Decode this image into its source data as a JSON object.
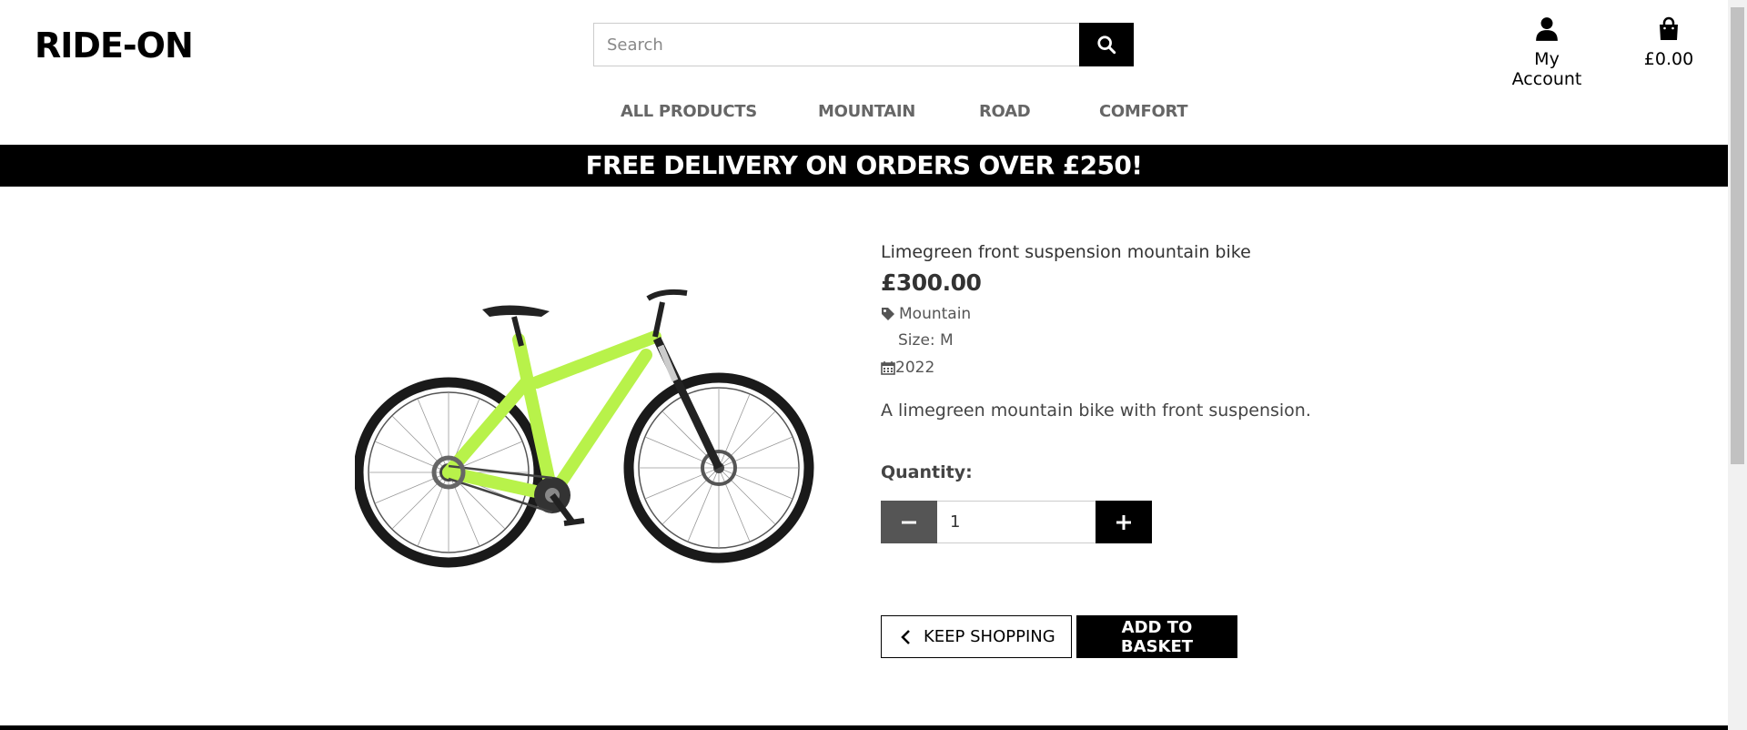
{
  "header": {
    "logo": "RIDE-ON",
    "search": {
      "placeholder": "Search",
      "value": ""
    },
    "account_label": "My Account",
    "basket_total": "£0.00"
  },
  "nav": {
    "items": [
      {
        "label": "ALL PRODUCTS"
      },
      {
        "label": "MOUNTAIN"
      },
      {
        "label": "ROAD"
      },
      {
        "label": "COMFORT"
      }
    ]
  },
  "banner": {
    "text": "FREE DELIVERY ON ORDERS OVER £250!"
  },
  "product": {
    "name": "Limegreen front suspension mountain bike",
    "price": "£300.00",
    "category": "Mountain",
    "size": "Size: M",
    "year": "2022",
    "description": "A limegreen mountain bike with front suspension.",
    "frame_color": "#b8f24a"
  },
  "quantity": {
    "label": "Quantity:",
    "value": "1"
  },
  "actions": {
    "keep_shopping": "KEEP SHOPPING",
    "add_to_basket": "ADD TO BASKET"
  },
  "icons": {
    "search": "search-icon",
    "account": "user-icon",
    "basket": "shopping-bag-icon",
    "tag": "tag-icon",
    "calendar": "calendar-icon",
    "minus": "minus-icon",
    "plus": "plus-icon",
    "chevron": "chevron-left-icon"
  }
}
